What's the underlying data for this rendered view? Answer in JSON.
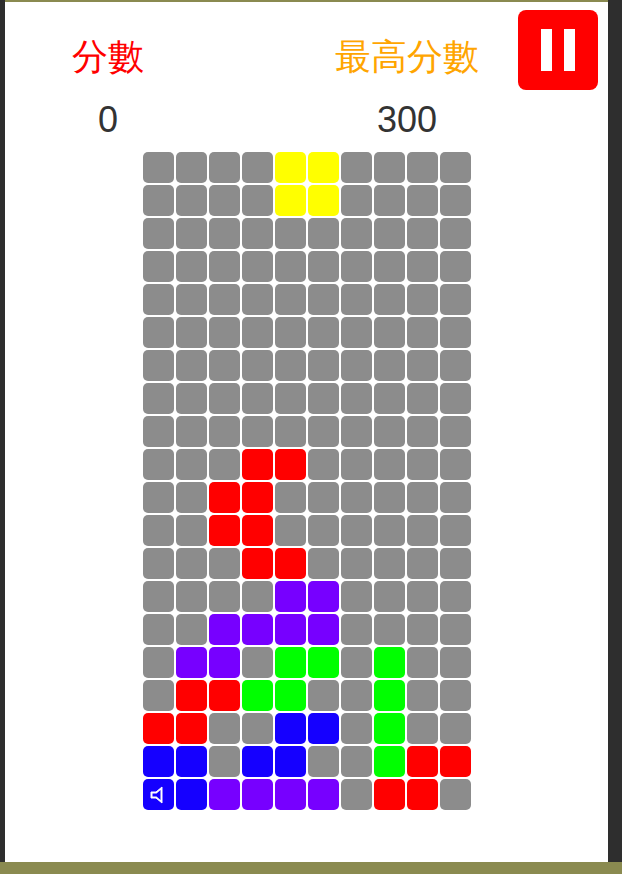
{
  "labels": {
    "score": "分數",
    "high_score": "最高分數"
  },
  "score": "0",
  "high_score": "300",
  "paused": false,
  "sound_on": true,
  "board": {
    "rows": [
      [
        null,
        null,
        null,
        null,
        "#ffff00",
        "#ffff00",
        null,
        null,
        null,
        null
      ],
      [
        null,
        null,
        null,
        null,
        "#ffff00",
        "#ffff00",
        null,
        null,
        null,
        null
      ],
      [
        null,
        null,
        null,
        null,
        null,
        null,
        null,
        null,
        null,
        null
      ],
      [
        null,
        null,
        null,
        null,
        null,
        null,
        null,
        null,
        null,
        null
      ],
      [
        null,
        null,
        null,
        null,
        null,
        null,
        null,
        null,
        null,
        null
      ],
      [
        null,
        null,
        null,
        null,
        null,
        null,
        null,
        null,
        null,
        null
      ],
      [
        null,
        null,
        null,
        null,
        null,
        null,
        null,
        null,
        null,
        null
      ],
      [
        null,
        null,
        null,
        null,
        null,
        null,
        null,
        null,
        null,
        null
      ],
      [
        null,
        null,
        null,
        null,
        null,
        null,
        null,
        null,
        null,
        null
      ],
      [
        null,
        null,
        null,
        "#ff0000",
        "#ff0000",
        null,
        null,
        null,
        null,
        null
      ],
      [
        null,
        null,
        "#ff0000",
        "#ff0000",
        null,
        null,
        null,
        null,
        null,
        null
      ],
      [
        null,
        null,
        "#ff0000",
        "#ff0000",
        null,
        null,
        null,
        null,
        null,
        null
      ],
      [
        null,
        null,
        null,
        "#ff0000",
        "#ff0000",
        null,
        null,
        null,
        null,
        null
      ],
      [
        null,
        null,
        null,
        null,
        "#7700ff",
        "#7700ff",
        null,
        null,
        null,
        null
      ],
      [
        null,
        null,
        "#7700ff",
        "#7700ff",
        "#7700ff",
        "#7700ff",
        null,
        null,
        null,
        null
      ],
      [
        null,
        "#7700ff",
        "#7700ff",
        null,
        "#00ff00",
        "#00ff00",
        null,
        "#00ff00",
        null,
        null
      ],
      [
        null,
        "#ff0000",
        "#ff0000",
        "#00ff00",
        "#00ff00",
        null,
        null,
        "#00ff00",
        null,
        null
      ],
      [
        "#ff0000",
        "#ff0000",
        null,
        null,
        "#1500ff",
        "#1500ff",
        null,
        "#00ff00",
        null,
        null
      ],
      [
        "#1500ff",
        "#1500ff",
        null,
        "#1500ff",
        "#1500ff",
        null,
        null,
        "#00ff00",
        "#ff0000",
        "#ff0000"
      ],
      [
        "#1500ff",
        "#1500ff",
        "#7700ff",
        "#7700ff",
        "#7700ff",
        "#7700ff",
        null,
        "#ff0000",
        "#ff0000",
        null
      ]
    ]
  }
}
